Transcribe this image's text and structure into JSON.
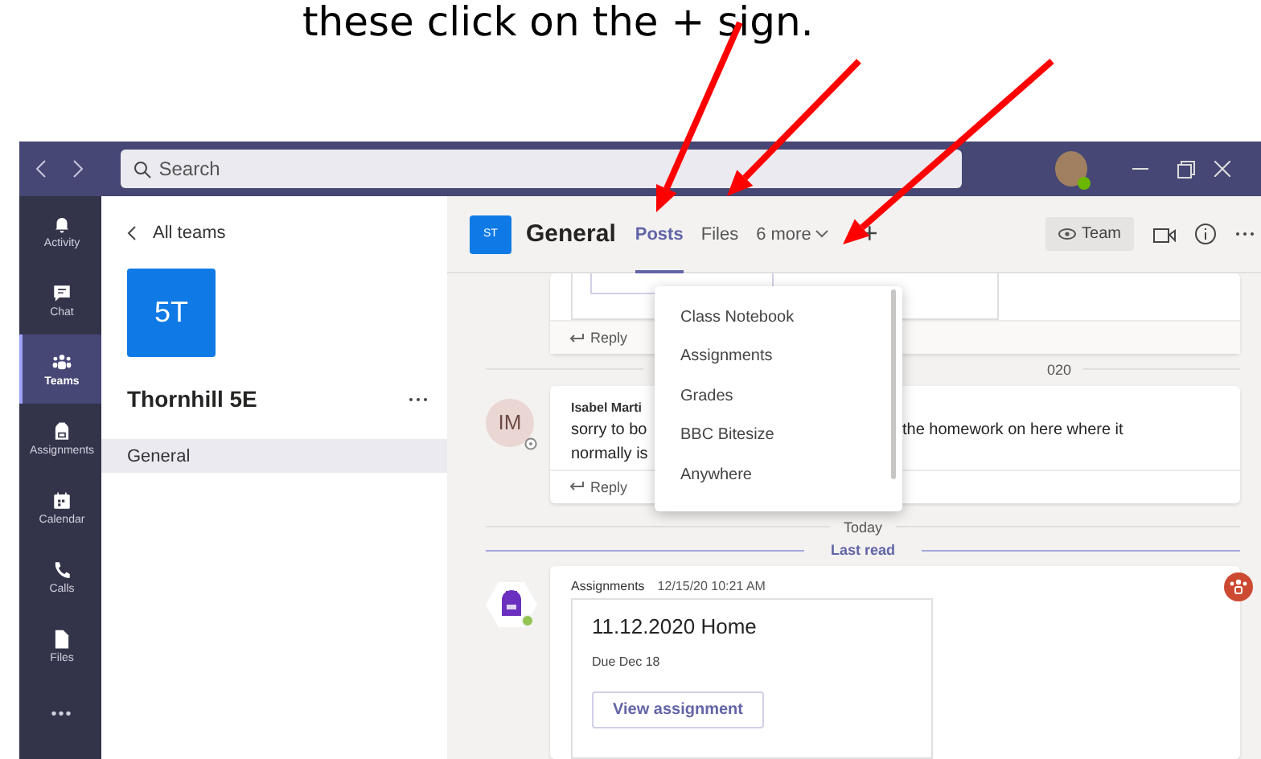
{
  "caption": "these click on the + sign.",
  "title_bar": {
    "search": {
      "placeholder": "Search"
    }
  },
  "rail": [
    {
      "label": "Activity",
      "selected": false
    },
    {
      "label": "Chat",
      "selected": false
    },
    {
      "label": "Teams",
      "selected": true
    },
    {
      "label": "Assignments",
      "selected": false
    },
    {
      "label": "Calendar",
      "selected": false
    },
    {
      "label": "Calls",
      "selected": false
    },
    {
      "label": "Files",
      "selected": false
    },
    {
      "label": "•••",
      "selected": false
    }
  ],
  "team_panel": {
    "back": "All teams",
    "team_initials": "5T",
    "team_name": "Thornhill 5E",
    "channels": [
      {
        "name": "General",
        "selected": true
      }
    ]
  },
  "channel_header": {
    "initials": "ST",
    "name": "General",
    "tabs": [
      {
        "label": "Posts",
        "selected": true
      },
      {
        "label": "Files",
        "selected": false
      }
    ],
    "more_tabs": "6 more",
    "add": "+",
    "team_button": "Team"
  },
  "feed": {
    "top_post": {
      "reply": "Reply"
    },
    "date_fragment": "020",
    "message": {
      "initials": "IM",
      "author": "Isabel Marti",
      "line_1_left": "sorry to bo",
      "line_1_right": "the homework on here where it",
      "line_2": "normally is",
      "reply": "Reply"
    },
    "today": "Today",
    "last_read": "Last read",
    "assignment_post": {
      "author": "Assignments",
      "time": "12/15/20 10:21 AM",
      "title": "11.12.2020 Home",
      "due": "Due Dec 18",
      "button": "View assignment"
    }
  },
  "tab_dropdown": {
    "items": [
      "Class Notebook",
      "Assignments",
      "Grades",
      "BBC Bitesize",
      "Anywhere"
    ]
  }
}
